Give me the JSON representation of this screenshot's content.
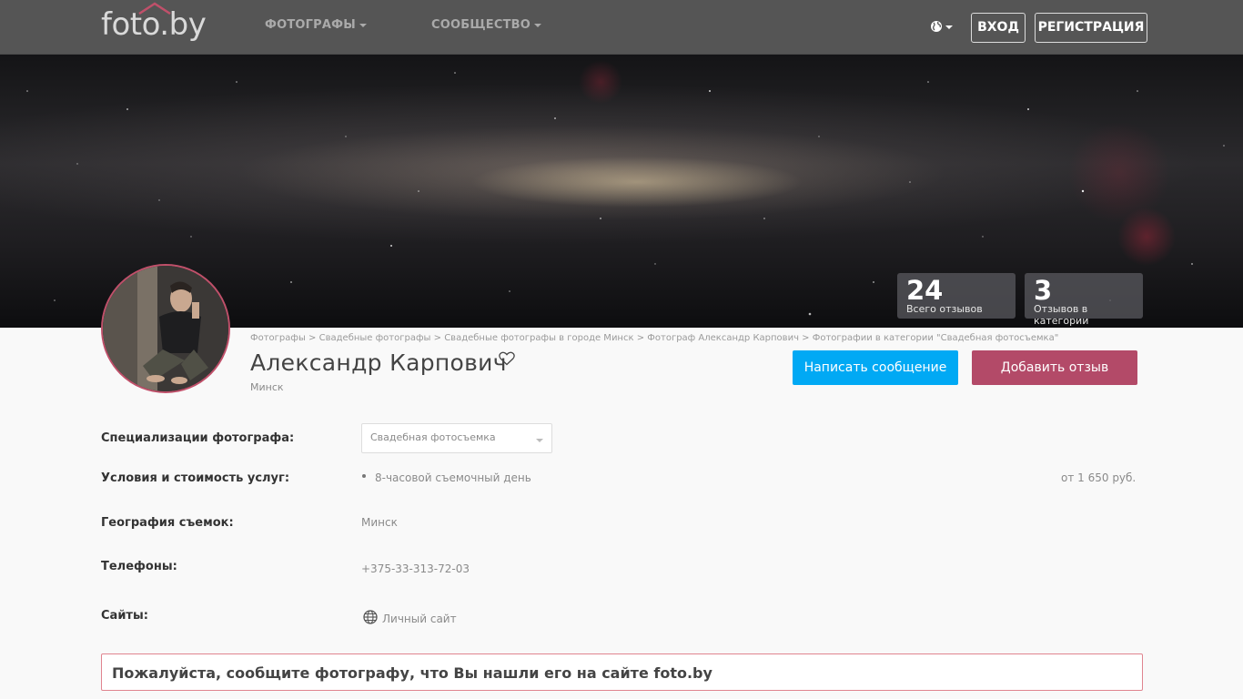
{
  "header": {
    "logo": "foto.by",
    "nav": [
      {
        "label": "ФОТОГРАФЫ"
      },
      {
        "label": "СООБЩЕСТВО"
      }
    ],
    "language_icon": "globe-icon",
    "login_label": "ВХОД",
    "register_label": "РЕГИСТРАЦИЯ"
  },
  "banner": {
    "stats": [
      {
        "value": "24",
        "label": "Всего отзывов"
      },
      {
        "value": "3",
        "label": "Отзывов в категории"
      }
    ]
  },
  "breadcrumb": [
    "Фотографы",
    "Свадебные фотографы",
    "Свадебные фотографы в городе Минск",
    "Фотограф Александр Карпович",
    "Фотографии в категории \"Свадебная фотосъемка\""
  ],
  "breadcrumb_separator": ">",
  "profile": {
    "name": "Александр Карпович",
    "city": "Минск",
    "message_button": "Написать сообщение",
    "review_button": "Добавить отзыв"
  },
  "details": {
    "specializations_label": "Специализации фотографа:",
    "specialization_selected": "Свадебная фотосъемка",
    "services_label": "Условия и стоимость услуг:",
    "service_name": "8-часовой съемочный день",
    "service_price": "от 1 650 руб.",
    "geography_label": "География съемок:",
    "geography_value": "Минск",
    "phones_label": "Телефоны:",
    "phone_value": "+375-33-313-72-03",
    "sites_label": "Сайты:",
    "site_value": "Личный сайт"
  },
  "notice": "Пожалуйста, сообщите фотографу, что Вы нашли его на сайте foto.by",
  "colors": {
    "header_bg": "#555555",
    "message_button": "#01a9f4",
    "review_button": "#b34a68",
    "notice_border": "#e0848f"
  }
}
